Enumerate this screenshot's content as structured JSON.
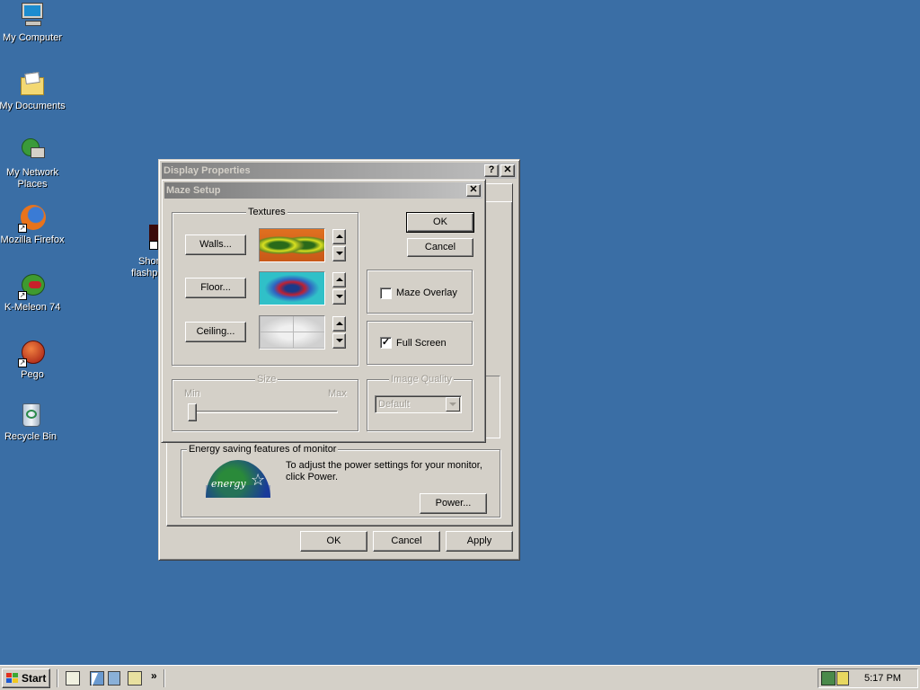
{
  "desktop": {
    "icons": [
      {
        "label": "My Computer"
      },
      {
        "label": "My Documents"
      },
      {
        "label": "My Network Places"
      },
      {
        "label": "Mozilla Firefox"
      },
      {
        "label": "K-Meleon 74"
      },
      {
        "label": "Pego"
      },
      {
        "label": "Recycle Bin"
      }
    ],
    "partial_icon_label_1": "Shor",
    "partial_icon_label_2": "flashp"
  },
  "display_properties": {
    "title": "Display Properties",
    "help_btn": "?",
    "close_btn": "✕",
    "energy_group_title": "Energy saving features of monitor",
    "energy_text": "To adjust the power settings for your monitor, click Power.",
    "energy_logo_text": "energy",
    "power_btn": "Power...",
    "ok_btn": "OK",
    "cancel_btn": "Cancel",
    "apply_btn": "Apply"
  },
  "maze_setup": {
    "title": "Maze Setup",
    "close_btn": "✕",
    "textures_title": "Textures",
    "walls_btn": "Walls...",
    "floor_btn": "Floor...",
    "ceiling_btn": "Ceiling...",
    "ok_btn": "OK",
    "cancel_btn": "Cancel",
    "maze_overlay_label": "Maze Overlay",
    "maze_overlay_checked": false,
    "full_screen_label": "Full Screen",
    "full_screen_checked": true,
    "check_mark": "✓",
    "size_title": "Size",
    "size_min": "Min",
    "size_max": "Max",
    "size_level": 0,
    "image_quality_title": "Image Quality",
    "image_quality_value": "Default"
  },
  "taskbar": {
    "start_label": "Start",
    "chevron": "»",
    "clock": "5:17 PM"
  }
}
